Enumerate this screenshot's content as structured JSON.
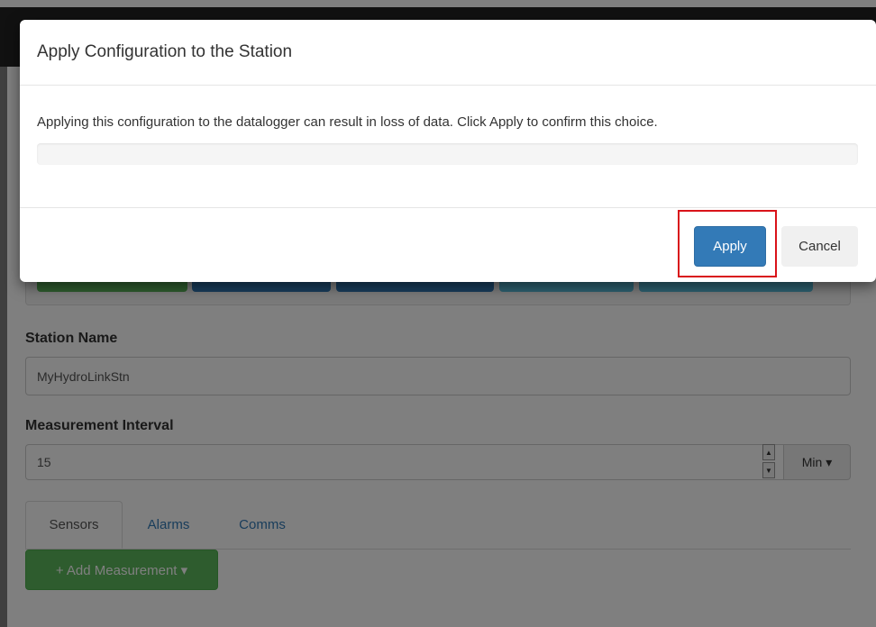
{
  "modal": {
    "title": "Apply Configuration to the Station",
    "message": "Applying this configuration to the datalogger can result in loss of data. Click Apply to confirm this choice.",
    "apply_label": "Apply",
    "cancel_label": "Cancel"
  },
  "form": {
    "station_name_label": "Station Name",
    "station_name_value": "MyHydroLinkStn",
    "interval_label": "Measurement Interval",
    "interval_value": "15",
    "interval_unit": "Min ▾"
  },
  "tabs": [
    {
      "label": "Sensors"
    },
    {
      "label": "Alarms"
    },
    {
      "label": "Comms"
    }
  ],
  "add_measurement_label": "+ Add Measurement ▾",
  "colors": {
    "primary": "#337ab7",
    "success": "#5cb85c",
    "info": "#5bc0de",
    "highlight": "#d9131a"
  }
}
